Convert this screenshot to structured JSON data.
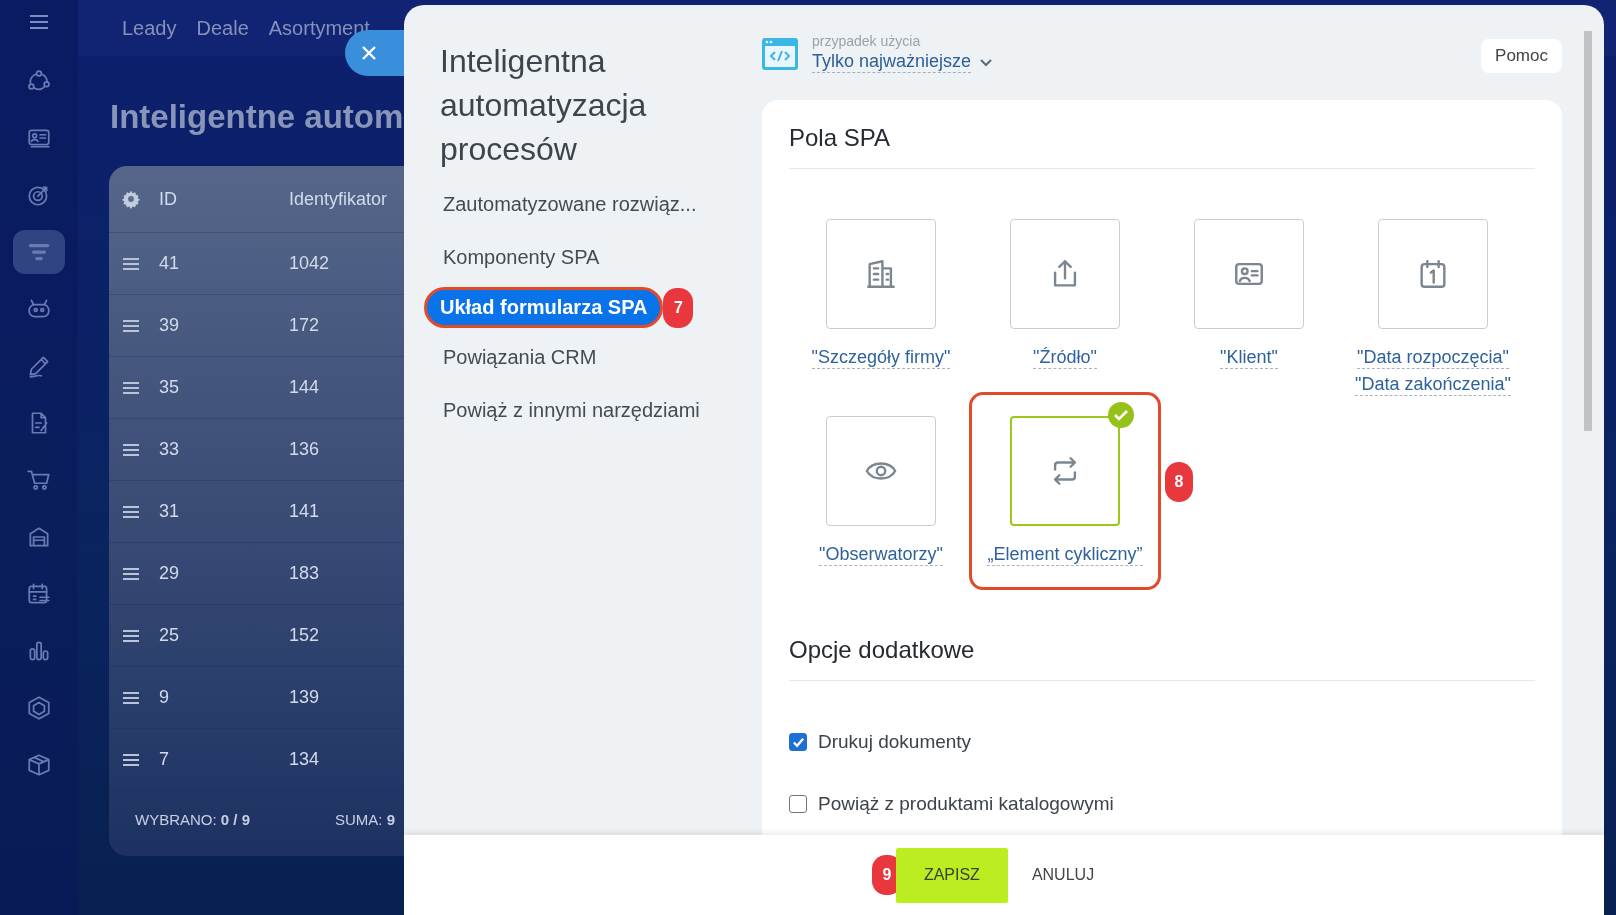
{
  "top_nav": {
    "items": [
      "Leady",
      "Deale",
      "Asortyment"
    ]
  },
  "sidebar": {
    "items": [
      {
        "selected": false
      },
      {
        "selected": false
      },
      {
        "selected": false
      },
      {
        "selected": true
      },
      {
        "selected": false
      },
      {
        "selected": false
      },
      {
        "selected": false
      },
      {
        "selected": false
      },
      {
        "selected": false
      },
      {
        "selected": false
      },
      {
        "selected": false
      },
      {
        "selected": false
      },
      {
        "selected": false
      }
    ]
  },
  "page": {
    "title": "Inteligentne autom"
  },
  "table": {
    "columns": [
      "ID",
      "Identyfikator"
    ],
    "rows": [
      {
        "id": "41",
        "identifier": "1042"
      },
      {
        "id": "39",
        "identifier": "172"
      },
      {
        "id": "35",
        "identifier": "144"
      },
      {
        "id": "33",
        "identifier": "136"
      },
      {
        "id": "31",
        "identifier": "141"
      },
      {
        "id": "29",
        "identifier": "183"
      },
      {
        "id": "25",
        "identifier": "152"
      },
      {
        "id": "9",
        "identifier": "139"
      },
      {
        "id": "7",
        "identifier": "134"
      }
    ],
    "footer": [
      "WYBRANO: **0 / 9**",
      "SUMA: **9**"
    ]
  },
  "panel": {
    "title": "Inteligentna automatyzacja procesów",
    "nav": [
      {
        "label": "Zautomatyzowane rozwiąz...",
        "selected": false
      },
      {
        "label": "Komponenty SPA",
        "selected": false
      },
      {
        "label": "Układ formularza SPA",
        "selected": true,
        "badge": "7"
      },
      {
        "label": "Powiązania CRM",
        "selected": false
      },
      {
        "label": "Powiąż z innymi narzędziami",
        "selected": false
      }
    ],
    "use_case": {
      "label": "przypadek użycia",
      "value": "Tylko najważniejsze"
    },
    "help_button": "Pomoc",
    "fields_section": {
      "title": "Pola SPA",
      "fields": [
        {
          "kind": "company",
          "labels": [
            "\"Szczegóły firmy\""
          ],
          "selected": false
        },
        {
          "kind": "source",
          "labels": [
            "\"Źródło\""
          ],
          "selected": false
        },
        {
          "kind": "client",
          "labels": [
            "\"Klient\""
          ],
          "selected": false
        },
        {
          "kind": "dates",
          "labels": [
            "\"Data rozpoczęcia\"",
            "\"Data zakończenia\""
          ],
          "selected": false
        },
        {
          "kind": "observers",
          "labels": [
            "\"Obserwatorzy\""
          ],
          "selected": false
        },
        {
          "kind": "recurring",
          "labels": [
            "„Element cykliczny”"
          ],
          "selected": true,
          "badge": "8"
        }
      ]
    },
    "options_section": {
      "title": "Opcje dodatkowe",
      "options": [
        {
          "label": "Drukuj dokumenty",
          "checked": true
        },
        {
          "label": "Powiąż z produktami katalogowymi",
          "checked": false
        }
      ]
    },
    "footer": {
      "buttons": [
        {
          "label": "ZAPISZ",
          "kind": "primary",
          "badge": "9"
        },
        {
          "label": "ANULUJ",
          "kind": "secondary"
        }
      ]
    }
  }
}
